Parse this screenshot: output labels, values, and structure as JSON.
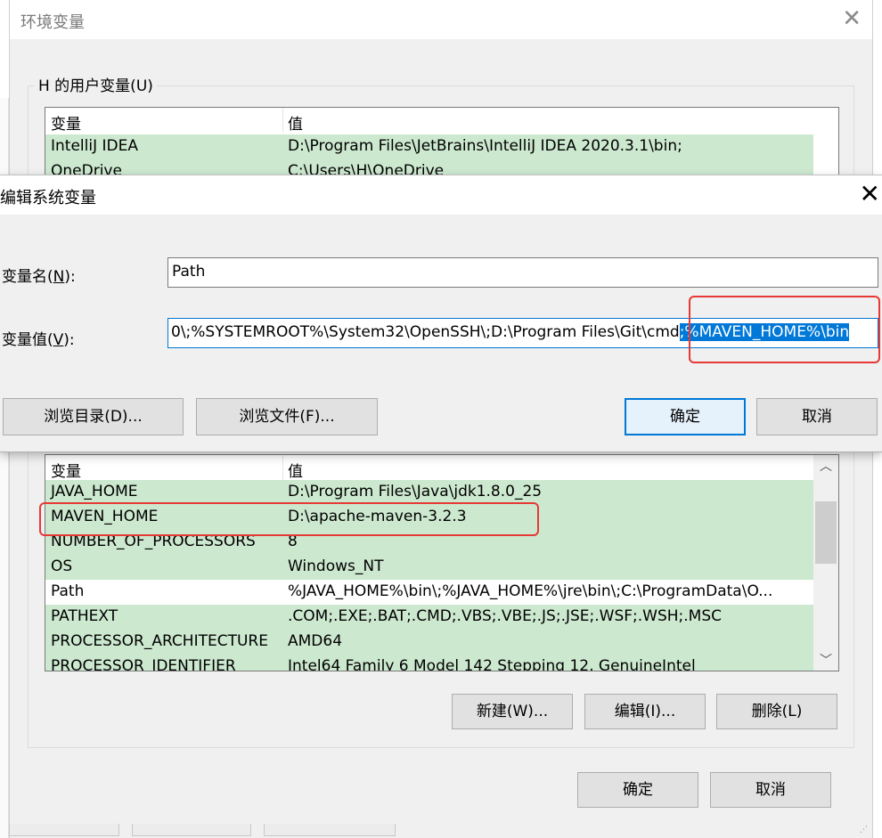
{
  "env_window": {
    "title": "环境变量",
    "user_group_label": "H 的用户变量(U)",
    "user_table": {
      "headers": [
        "变量",
        "值"
      ],
      "rows": [
        {
          "name": "IntelliJ IDEA",
          "value": "D:\\Program Files\\JetBrains\\IntelliJ IDEA 2020.3.1\\bin;"
        },
        {
          "name": "OneDrive",
          "value": "C:\\Users\\H\\OneDrive"
        }
      ]
    },
    "sys_table": {
      "headers": [
        "变量",
        "值"
      ],
      "rows": [
        {
          "name": "JAVA_HOME",
          "value": "D:\\Program Files\\Java\\jdk1.8.0_25"
        },
        {
          "name": "MAVEN_HOME",
          "value": "D:\\apache-maven-3.2.3"
        },
        {
          "name": "NUMBER_OF_PROCESSORS",
          "value": "8"
        },
        {
          "name": "OS",
          "value": "Windows_NT"
        },
        {
          "name": "Path",
          "value": "%JAVA_HOME%\\bin\\;%JAVA_HOME%\\jre\\bin\\;C:\\ProgramData\\O..."
        },
        {
          "name": "PATHEXT",
          "value": ".COM;.EXE;.BAT;.CMD;.VBS;.VBE;.JS;.JSE;.WSF;.WSH;.MSC"
        },
        {
          "name": "PROCESSOR_ARCHITECTURE",
          "value": "AMD64"
        },
        {
          "name": "PROCESSOR_IDENTIFIER",
          "value": "Intel64 Family 6 Model 142 Stepping 12, GenuineIntel"
        }
      ]
    },
    "buttons": {
      "new": "新建(W)...",
      "edit": "编辑(I)...",
      "delete": "删除(L)",
      "ok": "确定",
      "cancel": "取消"
    }
  },
  "edit_dialog": {
    "title": "编辑系统变量",
    "name_label": "变量名(",
    "name_key": "N",
    "name_label_end": "):",
    "name_value": "Path",
    "value_label": "变量值(",
    "value_key": "V",
    "value_label_end": "):",
    "value_text": "0\\;%SYSTEMROOT%\\System32\\OpenSSH\\;D:\\Program Files\\Git\\cmd",
    "value_selected": ";%MAVEN_HOME%\\bin",
    "buttons": {
      "browse_dir": "浏览目录(D)...",
      "browse_file": "浏览文件(F)...",
      "ok": "确定",
      "cancel": "取消"
    }
  },
  "colors": {
    "row_green": "#cce8cf",
    "selection_blue": "#0078d7",
    "annotation_red": "#e53935"
  }
}
